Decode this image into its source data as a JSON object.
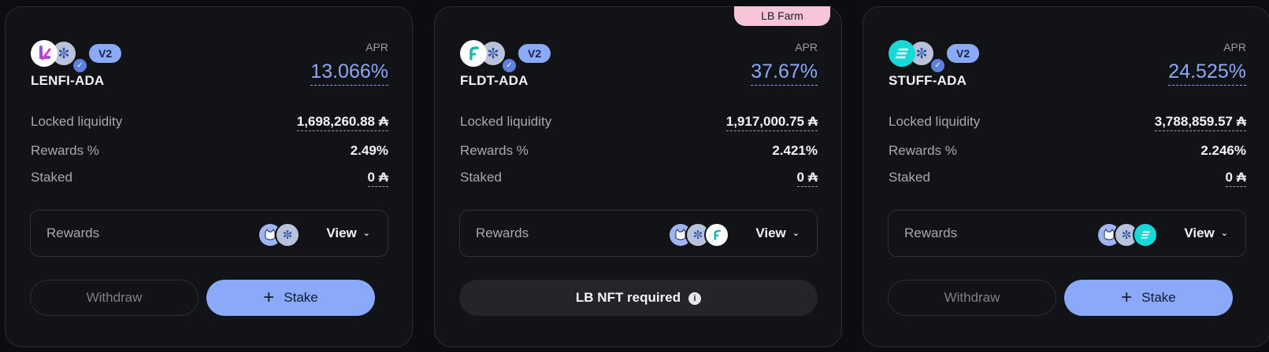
{
  "cards": [
    {
      "pair": "LENFI-ADA",
      "version": "V2",
      "apr_label": "APR",
      "apr": "13.066%",
      "locked_label": "Locked liquidity",
      "locked": "1,698,260.88 ₳",
      "rewards_pct_label": "Rewards %",
      "rewards_pct": "2.49%",
      "staked_label": "Staked",
      "staked": "0 ₳",
      "rewards_label": "Rewards",
      "view_label": "View",
      "withdraw_label": "Withdraw",
      "stake_label": "Stake",
      "token_icon": "lenfi-icon",
      "reward_icons": [
        "cat-token-icon",
        "cardano-icon"
      ]
    },
    {
      "pair": "FLDT-ADA",
      "version": "V2",
      "tag": "LB Farm",
      "apr_label": "APR",
      "apr": "37.67%",
      "locked_label": "Locked liquidity",
      "locked": "1,917,000.75 ₳",
      "rewards_pct_label": "Rewards %",
      "rewards_pct": "2.421%",
      "staked_label": "Staked",
      "staked": "0 ₳",
      "rewards_label": "Rewards",
      "view_label": "View",
      "lb_nft_label": "LB NFT required",
      "token_icon": "fluidtokens-icon",
      "reward_icons": [
        "cat-token-icon",
        "cardano-icon",
        "fluidtokens-icon"
      ]
    },
    {
      "pair": "STUFF-ADA",
      "version": "V2",
      "apr_label": "APR",
      "apr": "24.525%",
      "locked_label": "Locked liquidity",
      "locked": "3,788,859.57 ₳",
      "rewards_pct_label": "Rewards %",
      "rewards_pct": "2.246%",
      "staked_label": "Staked",
      "staked": "0 ₳",
      "rewards_label": "Rewards",
      "view_label": "View",
      "withdraw_label": "Withdraw",
      "stake_label": "Stake",
      "token_icon": "stuff-icon",
      "reward_icons": [
        "cat-token-icon",
        "cardano-icon",
        "stuff-icon"
      ]
    }
  ],
  "colors": {
    "accent": "#8aa9f8",
    "background": "#0c0d10",
    "card": "#121317",
    "tag": "#f7c4d8"
  }
}
